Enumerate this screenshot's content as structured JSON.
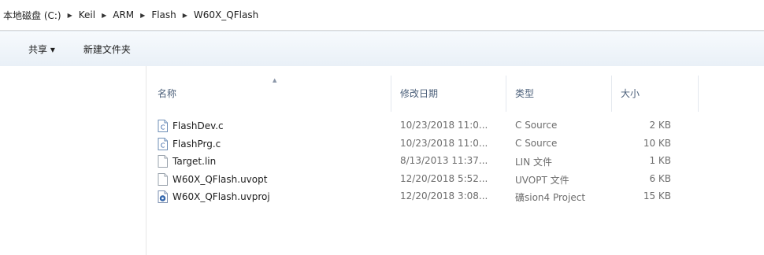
{
  "breadcrumb": {
    "segments": [
      "本地磁盘 (C:)",
      "Keil",
      "ARM",
      "Flash",
      "W60X_QFlash"
    ],
    "separator": "▶"
  },
  "toolbar": {
    "share_label": "共享 ▾",
    "new_folder_label": "新建文件夹"
  },
  "columns": {
    "name": "名称",
    "modified": "修改日期",
    "type": "类型",
    "size": "大小"
  },
  "files": [
    {
      "name": "FlashDev.c",
      "modified": "10/23/2018 11:0...",
      "type": "C Source",
      "size": "2 KB",
      "icon": "c-source-file-icon"
    },
    {
      "name": "FlashPrg.c",
      "modified": "10/23/2018 11:0...",
      "type": "C Source",
      "size": "10 KB",
      "icon": "c-source-file-icon"
    },
    {
      "name": "Target.lin",
      "modified": "8/13/2013 11:37...",
      "type": "LIN 文件",
      "size": "1 KB",
      "icon": "generic-file-icon"
    },
    {
      "name": "W60X_QFlash.uvopt",
      "modified": "12/20/2018 5:52...",
      "type": "UVOPT 文件",
      "size": "6 KB",
      "icon": "generic-file-icon"
    },
    {
      "name": "W60X_QFlash.uvproj",
      "modified": "12/20/2018 3:08...",
      "type": "礦sion4 Project",
      "size": "15 KB",
      "icon": "uvision-project-icon"
    }
  ],
  "colors": {
    "toolbar_top": "#f7fafd",
    "toolbar_bottom": "#e9f0f7",
    "header_text": "#4c607a",
    "secondary_text": "#6d6d6d"
  }
}
